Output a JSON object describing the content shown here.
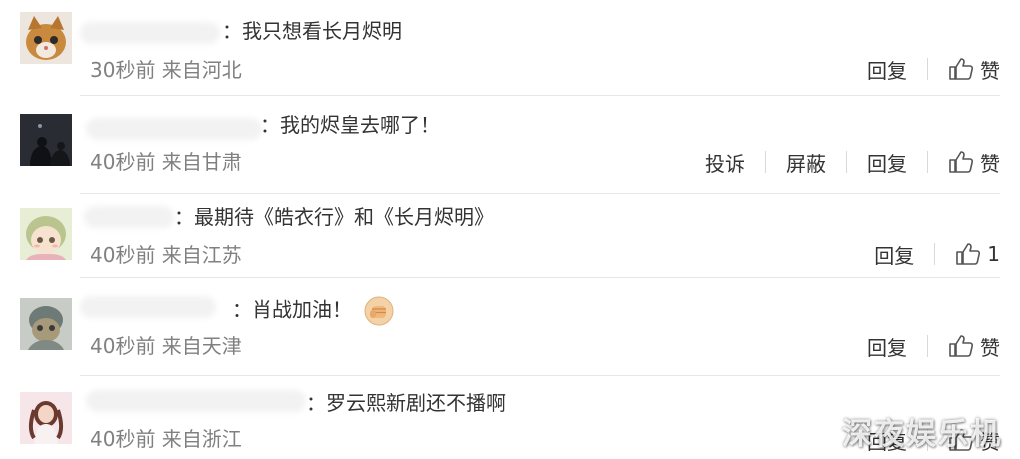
{
  "comments": [
    {
      "text": "：我只想看长月烬明",
      "meta": "30秒前 来自河北",
      "actions": [
        "回复"
      ],
      "like_label": "赞"
    },
    {
      "text": "：我的烬皇去哪了！",
      "meta": "40秒前 来自甘肃",
      "actions": [
        "投诉",
        "屏蔽",
        "回复"
      ],
      "like_label": "赞"
    },
    {
      "text": "：最期待《皓衣行》和《长月烬明》",
      "meta": "40秒前 来自江苏",
      "actions": [
        "回复"
      ],
      "like_label": "1"
    },
    {
      "text": "：肖战加油！",
      "emoji": "fist-emoji",
      "meta": "40秒前 来自天津",
      "actions": [
        "回复"
      ],
      "like_label": "赞"
    },
    {
      "text": "：罗云熙新剧还不播啊",
      "meta": "40秒前 来自浙江",
      "actions": [
        "回复"
      ],
      "like_label": "赞"
    }
  ],
  "icons": {
    "like": "thumbs-up-icon",
    "emoji": "fist-emoji-icon"
  },
  "colors": {
    "text": "#333333",
    "meta": "#808080",
    "divider": "#e6e6e6"
  },
  "watermark": "深夜娱乐机"
}
